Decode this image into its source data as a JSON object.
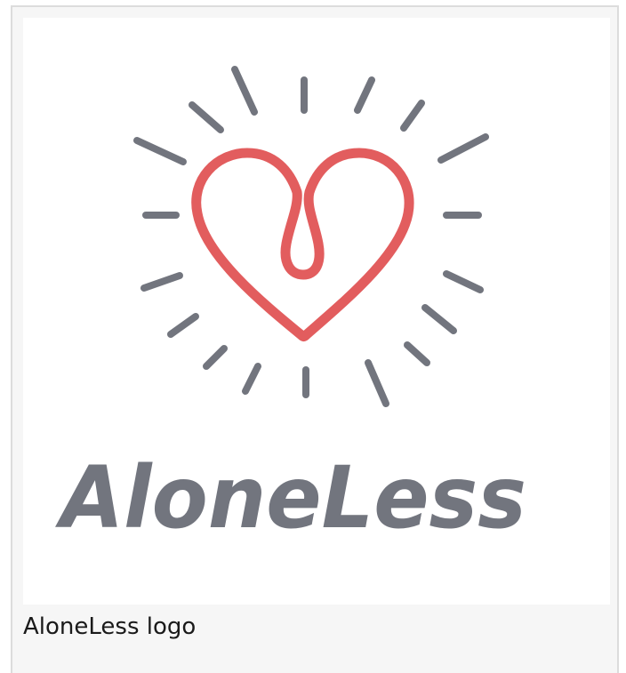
{
  "figure": {
    "logo": {
      "wordmark": "AloneLess",
      "heart_color": "#e25d5e",
      "ray_color": "#72757e",
      "wordmark_color": "#72757e"
    },
    "caption": "AloneLess logo"
  }
}
